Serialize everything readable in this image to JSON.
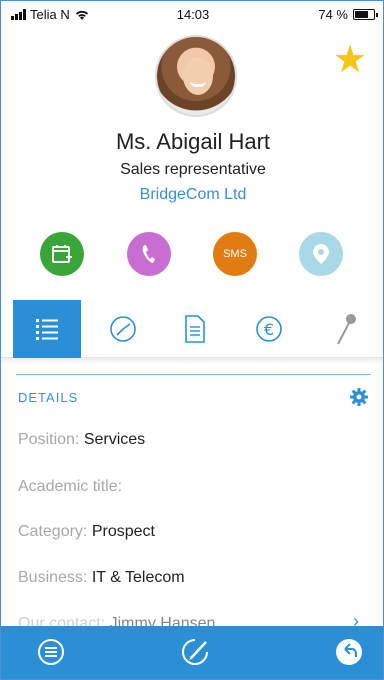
{
  "status_bar": {
    "carrier": "Telia N",
    "time": "14:03",
    "battery": "74 %",
    "battery_level": 0.74
  },
  "contact": {
    "name": "Ms. Abigail Hart",
    "role": "Sales representative",
    "company": "BridgeCom Ltd",
    "favorite": true
  },
  "actions": [
    {
      "icon": "calendar-add-icon",
      "color": "#3aa63a"
    },
    {
      "icon": "phone-icon",
      "color": "#c86ed0"
    },
    {
      "icon": "sms-icon",
      "label": "SMS",
      "color": "#e07c12"
    },
    {
      "icon": "location-pin-icon",
      "color": "#a9d8e6"
    }
  ],
  "tabs": [
    {
      "icon": "list-icon",
      "active": true
    },
    {
      "icon": "clock-icon",
      "active": false
    },
    {
      "icon": "document-icon",
      "active": false
    },
    {
      "icon": "euro-icon",
      "active": false
    },
    {
      "icon": "pin-icon",
      "active": false
    }
  ],
  "details": {
    "heading": "DETAILS",
    "fields": [
      {
        "label": "Position:",
        "value": "Services"
      },
      {
        "label": "Academic title:",
        "value": ""
      },
      {
        "label": "Category:",
        "value": "Prospect"
      },
      {
        "label": "Business:",
        "value": "IT & Telecom"
      },
      {
        "label": "Our contact:",
        "value": "Jimmy Hansen"
      }
    ]
  },
  "bottom_bar": {
    "items": [
      "menu-icon",
      "edit-icon",
      "back-icon"
    ]
  },
  "colors": {
    "accent": "#2b8fd6",
    "link": "#3b8ec9",
    "star": "#f5c518"
  }
}
